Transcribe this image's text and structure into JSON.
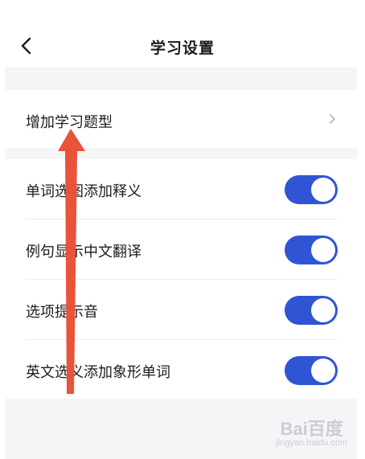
{
  "header": {
    "title": "学习设置",
    "back_icon": "chevron-left-icon"
  },
  "add_question_type": {
    "label": "增加学习题型",
    "chevron_icon": "chevron-right-icon"
  },
  "settings": [
    {
      "label": "单词选图添加释义",
      "enabled": true
    },
    {
      "label": "例句显示中文翻译",
      "enabled": true
    },
    {
      "label": "选项提示音",
      "enabled": true
    },
    {
      "label": "英文选义添加象形单词",
      "enabled": true
    }
  ],
  "watermark": {
    "logo": "Bai百度",
    "url": "jingyan.baidu.com"
  },
  "colors": {
    "toggle_on": "#2f55d4",
    "annotation_arrow": "#e8533a",
    "section_gap": "#f5f5f7"
  }
}
